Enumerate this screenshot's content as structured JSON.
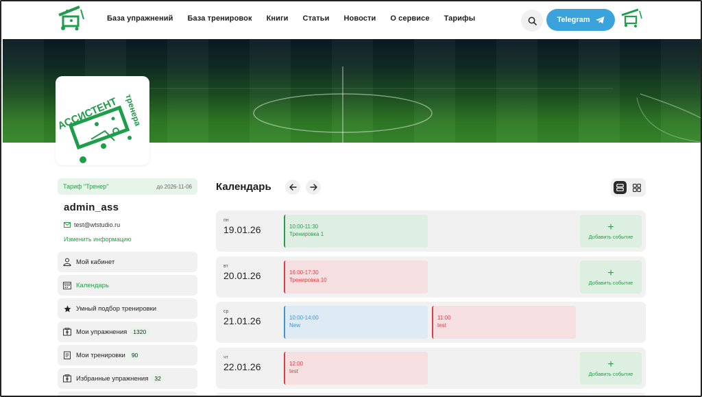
{
  "header": {
    "logo_name": "logo",
    "nav": [
      "База упражнений",
      "База тренировок",
      "Книги",
      "Статьи",
      "Новости",
      "О сервисе",
      "Тарифы"
    ],
    "telegram_label": "Telegram"
  },
  "logo": {
    "text_main": "АССИСТЕНТ",
    "text_side": "тренера"
  },
  "profile": {
    "tariff_name": "Тариф \"Тренер\"",
    "tariff_date": "до 2026-11-06",
    "username": "admin_ass",
    "email": "test@wtstudio.ru",
    "edit_link": "Изменить информацию"
  },
  "menu": [
    {
      "label": "Мой кабинет",
      "icon": "user-icon"
    },
    {
      "label": "Календарь",
      "icon": "calendar-icon",
      "active": true
    },
    {
      "label": "Умный подбор тренировки",
      "icon": "star-icon"
    },
    {
      "label": "Мои упражнения",
      "icon": "field-icon",
      "count": "1320"
    },
    {
      "label": "Мои тренировки",
      "icon": "clipboard-icon",
      "count": "90"
    },
    {
      "label": "Избранные упражнения",
      "icon": "field-icon",
      "count": "32"
    }
  ],
  "calendar": {
    "title": "Календарь",
    "add_label": "Добавить событие",
    "days": [
      {
        "dow": "пн",
        "date": "19.01.26",
        "events": [
          {
            "time": "10:00-11:30",
            "name": "Тренировка 1",
            "color": "green"
          }
        ],
        "show_add": true
      },
      {
        "dow": "вт",
        "date": "20.01.26",
        "events": [
          {
            "time": "16:00-17:30",
            "name": "Тренировка 10",
            "color": "red"
          }
        ],
        "show_add": true
      },
      {
        "dow": "ср",
        "date": "21.01.26",
        "events": [
          {
            "time": "10:00-14:00",
            "name": "New",
            "color": "blue"
          },
          {
            "time": "11:00",
            "name": "test",
            "color": "red"
          }
        ],
        "show_add": false
      },
      {
        "dow": "чт",
        "date": "22.01.26",
        "events": [
          {
            "time": "12:00",
            "name": "test",
            "color": "red"
          }
        ],
        "show_add": true
      }
    ]
  },
  "colors": {
    "brand_green": "#2a9a48",
    "telegram_blue": "#3aa3dc",
    "event_red": "#e03c46",
    "event_blue": "#3d94d6"
  }
}
